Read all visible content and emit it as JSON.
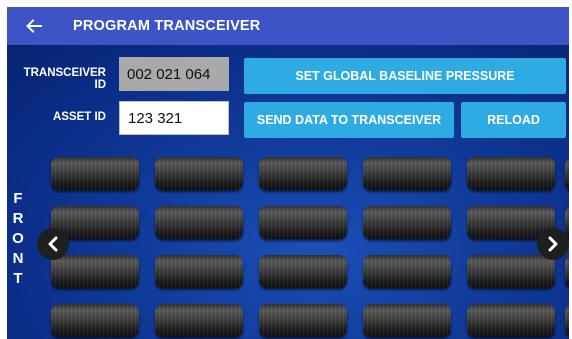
{
  "header": {
    "title": "PROGRAM TRANSCEIVER",
    "back_icon": "arrow-left-icon"
  },
  "form": {
    "transceiver_label": "TRANSCEIVER ID",
    "transceiver_value": "002 021 064",
    "asset_label": "ASSET ID",
    "asset_value": "123 321"
  },
  "buttons": {
    "set_baseline": "SET GLOBAL BASELINE PRESSURE",
    "send_data": "SEND DATA TO TRANSCEIVER",
    "reload": "RELOAD"
  },
  "grid": {
    "side_label": [
      "F",
      "R",
      "O",
      "N",
      "T"
    ],
    "rows": 4,
    "columns": 5,
    "prev_icon": "chevron-left-icon",
    "next_icon": "chevron-right-icon"
  },
  "colors": {
    "appbar": "#3d53c6",
    "background": "#0a2c86",
    "button": "#2eabe2",
    "transceiver_field": "#a9a9a9"
  }
}
